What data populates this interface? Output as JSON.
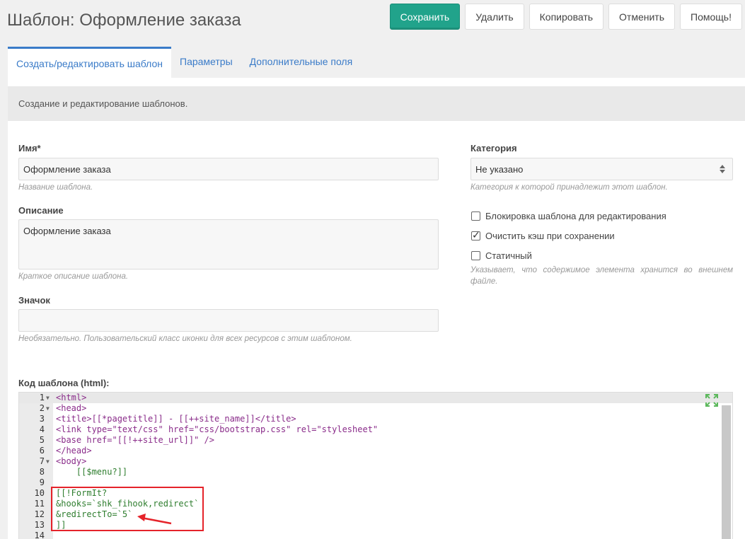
{
  "header": {
    "title": "Шаблон: Оформление заказа",
    "buttons": {
      "save": "Сохранить",
      "delete": "Удалить",
      "copy": "Копировать",
      "cancel": "Отменить",
      "help": "Помощь!"
    }
  },
  "tabs": [
    {
      "label": "Создать/редактировать шаблон",
      "active": true
    },
    {
      "label": "Параметры",
      "active": false
    },
    {
      "label": "Дополнительные поля",
      "active": false
    }
  ],
  "panel": {
    "description": "Создание и редактирование шаблонов."
  },
  "form": {
    "name": {
      "label": "Имя*",
      "value": "Оформление заказа",
      "hint": "Название шаблона."
    },
    "description": {
      "label": "Описание",
      "value": "Оформление заказа",
      "hint": "Краткое описание шаблона."
    },
    "icon": {
      "label": "Значок",
      "value": "",
      "hint": "Необязательно. Пользовательский класс иконки для всех ресурсов с этим шаблоном."
    },
    "category": {
      "label": "Категория",
      "value": "Не указано",
      "hint": "Категория к которой принадлежит этот шаблон."
    },
    "checkboxes": [
      {
        "label": "Блокировка шаблона для редактирования",
        "checked": false
      },
      {
        "label": "Очистить кэш при сохранении",
        "checked": true
      },
      {
        "label": "Статичный",
        "checked": false
      }
    ],
    "static_hint": "Указывает, что содержимое элемента хранится во внешнем файле.",
    "code_label": "Код шаблона (html):"
  },
  "editor": {
    "lines": [
      {
        "n": "1",
        "fold": true,
        "text": "<html>"
      },
      {
        "n": "2",
        "fold": true,
        "text": "<head>"
      },
      {
        "n": "3",
        "fold": false,
        "text": "<title>[[*pagetitle]] - [[++site_name]]</title>"
      },
      {
        "n": "4",
        "fold": false,
        "text": "<link type=\"text/css\" href=\"css/bootstrap.css\" rel=\"stylesheet\""
      },
      {
        "n": "5",
        "fold": false,
        "text": "<base href=\"[[!++site_url]]\" />"
      },
      {
        "n": "6",
        "fold": false,
        "text": "</head>"
      },
      {
        "n": "7",
        "fold": true,
        "text": "<body>"
      },
      {
        "n": "8",
        "fold": false,
        "text": "    [[$menu?]]"
      },
      {
        "n": "9",
        "fold": false,
        "text": ""
      },
      {
        "n": "10",
        "fold": false,
        "text": "[[!FormIt?"
      },
      {
        "n": "11",
        "fold": false,
        "text": "&hooks=`shk_fihook,redirect`"
      },
      {
        "n": "12",
        "fold": false,
        "text": "&redirectTo=`5`"
      },
      {
        "n": "13",
        "fold": false,
        "text": "]]"
      },
      {
        "n": "14",
        "fold": false,
        "text": ""
      }
    ]
  },
  "annotation_color": "#e5232a"
}
